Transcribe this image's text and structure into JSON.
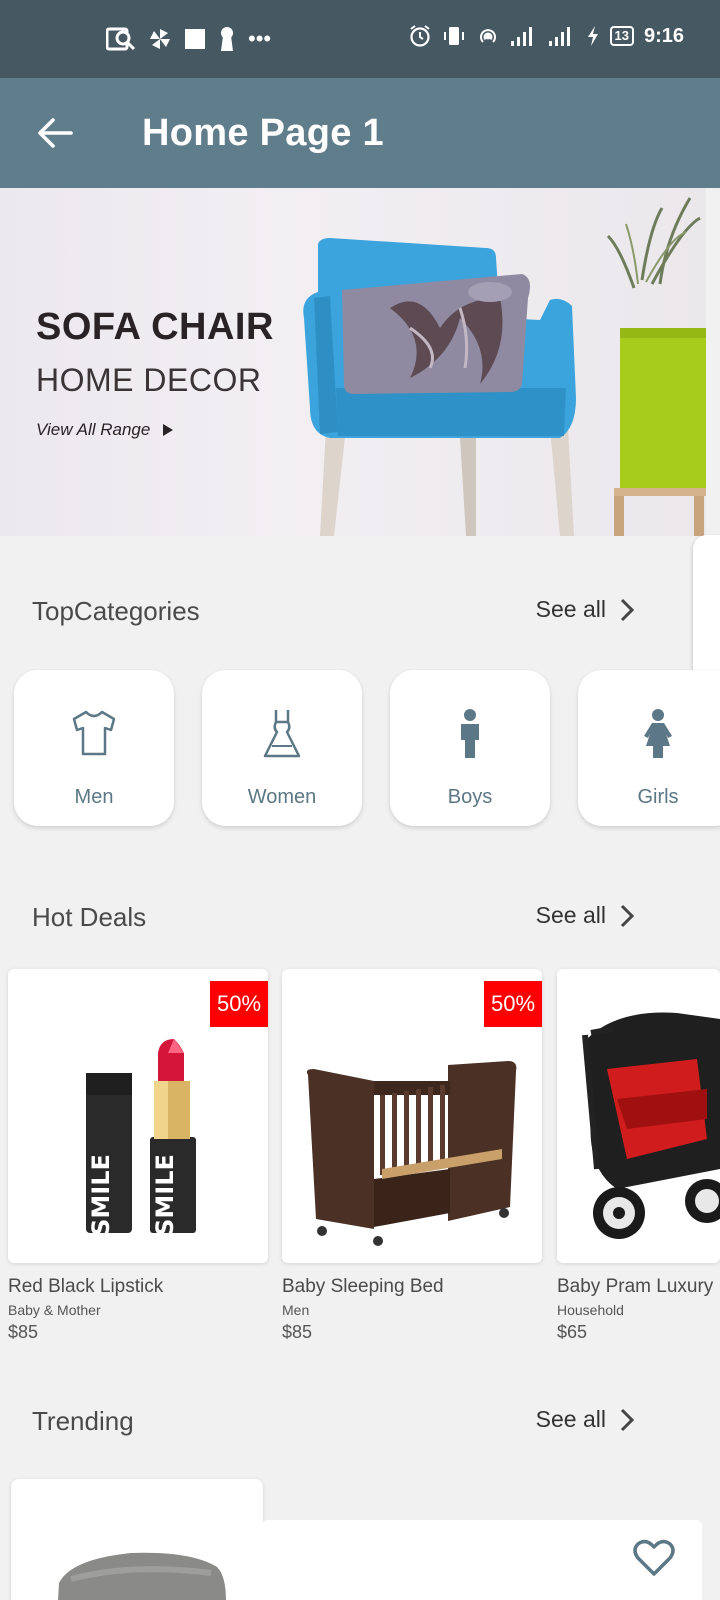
{
  "status_bar": {
    "time": "9:16",
    "battery": "13",
    "left_icons": [
      "scan-icon",
      "pinwheel-icon",
      "square-icon",
      "keyhole-icon",
      "more-dots-icon"
    ],
    "right_icons": [
      "alarm-icon",
      "vibrate-icon",
      "hotspot-icon",
      "signal-icon",
      "signal-icon",
      "charging-icon"
    ]
  },
  "app_bar": {
    "title": "Home Page 1",
    "back_icon": "arrow-left-icon",
    "background": "#607d8b"
  },
  "banner": {
    "title": "SOFA CHAIR",
    "subtitle": "HOME DECOR",
    "link": "View All Range"
  },
  "top_categories": {
    "title": "TopCategories",
    "see_all": "See all",
    "items": [
      {
        "label": "Men",
        "icon": "tshirt-icon"
      },
      {
        "label": "Women",
        "icon": "dress-icon"
      },
      {
        "label": "Boys",
        "icon": "boy-icon"
      },
      {
        "label": "Girls",
        "icon": "girl-icon"
      }
    ]
  },
  "hot_deals": {
    "title": "Hot Deals",
    "see_all": "See all",
    "products": [
      {
        "name": "Red Black Lipstick",
        "category": "Baby & Mother",
        "price": "$85",
        "badge": "50%",
        "product_text": "SMILE"
      },
      {
        "name": "Baby Sleeping Bed",
        "category": "Men",
        "price": "$85",
        "badge": "50%"
      },
      {
        "name": "Baby Pram Luxury",
        "category": "Household",
        "price": "$65"
      }
    ]
  },
  "trending": {
    "title": "Trending",
    "see_all": "See all"
  },
  "colors": {
    "status_bar": "#465862",
    "app_bar": "#607d8b",
    "accent": "#5c7785",
    "badge": "#ff0000"
  }
}
